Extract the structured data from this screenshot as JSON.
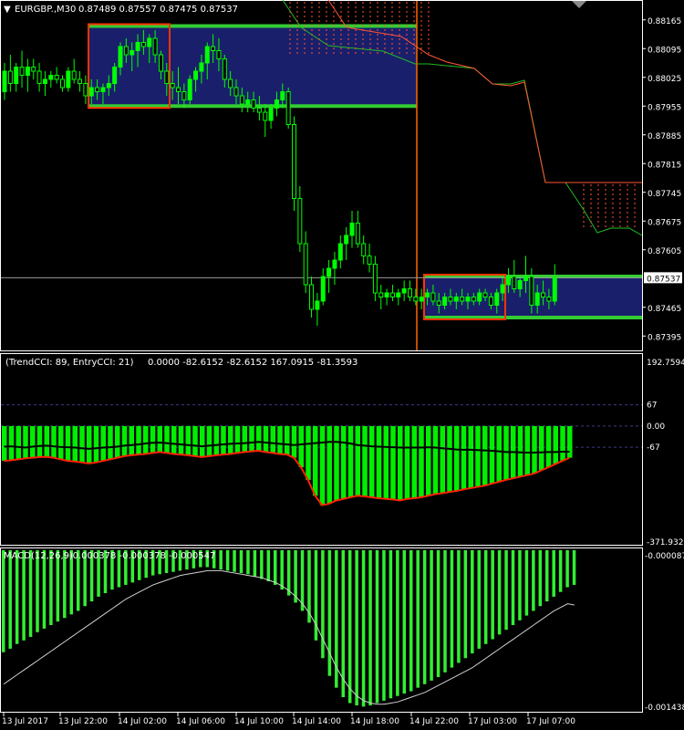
{
  "header": {
    "symbol_label": "EURGBP.,M30",
    "ohlc": "0.87489 0.87557 0.87475 0.87537"
  },
  "indicators": {
    "cci_label": "(TrendCCI: 89, EntryCCI: 21)",
    "cci_values": "0.0000 -82.6152 -82.6152 167.0915 -81.3593",
    "macd_label": "MACD(12,26,9)",
    "macd_values": "-0.000378 -0.000378 -0.000547"
  },
  "colors": {
    "background": "#000000",
    "grid_text": "#ffffff",
    "bull": "#00ff00",
    "bear": "#00ff00",
    "box_fill": "#1a1f6b",
    "box_edge_green": "#33cc33",
    "box_edge_red": "#ff3300",
    "ichimoku_red": "#ff5533",
    "ichimoku_green": "#22bb22",
    "price_line": "#9a9a9a",
    "vline": "#ff6600",
    "cci_hist": "#00ee00",
    "cci_line_red": "#ff2200",
    "cci_line_black": "#000000",
    "macd_hist": "#33ee33",
    "macd_signal": "#cfcfcf"
  },
  "chart_data": [
    {
      "type": "candlestick",
      "title": "EURGBP.,M30",
      "price_axis_ticks": [
        "0.88165",
        "0.88095",
        "0.88025",
        "0.87955",
        "0.87885",
        "0.87815",
        "0.87745",
        "0.87675",
        "0.87605",
        "0.87537",
        "0.87465",
        "0.87395"
      ],
      "current_price_label": "0.87537",
      "ylim": [
        0.8736,
        0.882
      ],
      "time_axis_labels": [
        "13 Jul 2017",
        "13 Jul 22:00",
        "14 Jul 02:00",
        "14 Jul 06:00",
        "14 Jul 10:00",
        "14 Jul 14:00",
        "14 Jul 18:00",
        "14 Jul 22:00",
        "17 Jul 03:00",
        "17 Jul 07:00"
      ],
      "candles": [
        [
          0.8799,
          0.8806,
          0.8797,
          0.8804
        ],
        [
          0.8804,
          0.8808,
          0.8799,
          0.8801
        ],
        [
          0.8801,
          0.8806,
          0.8799,
          0.8805
        ],
        [
          0.8805,
          0.8809,
          0.88,
          0.8803
        ],
        [
          0.8803,
          0.8807,
          0.8799,
          0.8805
        ],
        [
          0.8805,
          0.8807,
          0.8802,
          0.8804
        ],
        [
          0.8804,
          0.8806,
          0.8799,
          0.8801
        ],
        [
          0.8801,
          0.8804,
          0.8798,
          0.8802
        ],
        [
          0.8802,
          0.8804,
          0.88,
          0.8803
        ],
        [
          0.8803,
          0.8805,
          0.8801,
          0.8802
        ],
        [
          0.8802,
          0.8803,
          0.8799,
          0.88
        ],
        [
          0.88,
          0.8805,
          0.8799,
          0.8804
        ],
        [
          0.8804,
          0.8807,
          0.8801,
          0.8802
        ],
        [
          0.8802,
          0.8804,
          0.8799,
          0.8801
        ],
        [
          0.8801,
          0.8803,
          0.8796,
          0.8798
        ],
        [
          0.8798,
          0.8802,
          0.8796,
          0.88
        ],
        [
          0.88,
          0.8802,
          0.8797,
          0.8799
        ],
        [
          0.8799,
          0.8801,
          0.8796,
          0.88
        ],
        [
          0.88,
          0.8803,
          0.8798,
          0.8801
        ],
        [
          0.8801,
          0.8806,
          0.8799,
          0.8805
        ],
        [
          0.8805,
          0.8811,
          0.8803,
          0.881
        ],
        [
          0.881,
          0.8812,
          0.8806,
          0.8808
        ],
        [
          0.8808,
          0.8811,
          0.8804,
          0.8809
        ],
        [
          0.8809,
          0.8813,
          0.8805,
          0.8811
        ],
        [
          0.8811,
          0.8814,
          0.8808,
          0.881
        ],
        [
          0.881,
          0.8813,
          0.8806,
          0.8812
        ],
        [
          0.8812,
          0.8814,
          0.8806,
          0.8808
        ],
        [
          0.8808,
          0.8809,
          0.8802,
          0.8804
        ],
        [
          0.8804,
          0.8806,
          0.8798,
          0.8801
        ],
        [
          0.8801,
          0.8804,
          0.8797,
          0.88
        ],
        [
          0.88,
          0.8805,
          0.8796,
          0.8799
        ],
        [
          0.8799,
          0.8801,
          0.8795,
          0.8797
        ],
        [
          0.8797,
          0.8803,
          0.8796,
          0.8802
        ],
        [
          0.8802,
          0.8805,
          0.8799,
          0.8804
        ],
        [
          0.8804,
          0.8808,
          0.8801,
          0.8806
        ],
        [
          0.8806,
          0.8811,
          0.8802,
          0.881
        ],
        [
          0.881,
          0.8813,
          0.8806,
          0.8809
        ],
        [
          0.8809,
          0.8812,
          0.8804,
          0.8807
        ],
        [
          0.8807,
          0.8808,
          0.88,
          0.8802
        ],
        [
          0.8802,
          0.8804,
          0.8798,
          0.88
        ],
        [
          0.88,
          0.8802,
          0.8796,
          0.8798
        ],
        [
          0.8798,
          0.88,
          0.8794,
          0.8796
        ],
        [
          0.8796,
          0.8799,
          0.8794,
          0.8797
        ],
        [
          0.8797,
          0.8799,
          0.8794,
          0.8795
        ],
        [
          0.8795,
          0.8798,
          0.8792,
          0.8794
        ],
        [
          0.8794,
          0.8796,
          0.8788,
          0.8792
        ],
        [
          0.8792,
          0.8796,
          0.879,
          0.8795
        ],
        [
          0.8795,
          0.8799,
          0.8793,
          0.8797
        ],
        [
          0.8797,
          0.8801,
          0.8795,
          0.8799
        ],
        [
          0.8799,
          0.88,
          0.879,
          0.8791
        ],
        [
          0.8791,
          0.8793,
          0.877,
          0.8773
        ],
        [
          0.8773,
          0.8776,
          0.876,
          0.8762
        ],
        [
          0.8762,
          0.8765,
          0.875,
          0.8752
        ],
        [
          0.8752,
          0.8754,
          0.8744,
          0.8746
        ],
        [
          0.8746,
          0.875,
          0.8742,
          0.8748
        ],
        [
          0.8748,
          0.8756,
          0.8747,
          0.8754
        ],
        [
          0.8754,
          0.8758,
          0.875,
          0.8756
        ],
        [
          0.8756,
          0.876,
          0.8752,
          0.8758
        ],
        [
          0.8758,
          0.8764,
          0.8756,
          0.8762
        ],
        [
          0.8762,
          0.8766,
          0.8758,
          0.8764
        ],
        [
          0.8764,
          0.877,
          0.8761,
          0.8767
        ],
        [
          0.8767,
          0.877,
          0.8761,
          0.8762
        ],
        [
          0.8762,
          0.8764,
          0.8757,
          0.8759
        ],
        [
          0.8759,
          0.8762,
          0.8755,
          0.8757
        ],
        [
          0.8757,
          0.8759,
          0.8748,
          0.875
        ],
        [
          0.875,
          0.8752,
          0.8746,
          0.8749
        ],
        [
          0.8749,
          0.8751,
          0.8747,
          0.875
        ],
        [
          0.875,
          0.8752,
          0.8748,
          0.8749
        ],
        [
          0.8749,
          0.8751,
          0.8747,
          0.875
        ],
        [
          0.875,
          0.8753,
          0.8748,
          0.8751
        ],
        [
          0.8751,
          0.8753,
          0.8748,
          0.8749
        ],
        [
          0.8749,
          0.8751,
          0.8747,
          0.8748
        ],
        [
          0.8748,
          0.8751,
          0.8746,
          0.8749
        ],
        [
          0.8749,
          0.8751,
          0.8747,
          0.875
        ],
        [
          0.875,
          0.8752,
          0.8747,
          0.8748
        ],
        [
          0.8748,
          0.875,
          0.8745,
          0.8747
        ],
        [
          0.8747,
          0.875,
          0.8746,
          0.8749
        ],
        [
          0.8749,
          0.8751,
          0.8747,
          0.8748
        ],
        [
          0.8748,
          0.875,
          0.8746,
          0.8749
        ],
        [
          0.8749,
          0.8751,
          0.8747,
          0.8748
        ],
        [
          0.8748,
          0.875,
          0.8746,
          0.8749
        ],
        [
          0.8749,
          0.875,
          0.8747,
          0.8748
        ],
        [
          0.8748,
          0.8751,
          0.8747,
          0.875
        ],
        [
          0.875,
          0.8751,
          0.8748,
          0.8749
        ],
        [
          0.8749,
          0.875,
          0.8746,
          0.8747
        ],
        [
          0.8747,
          0.8751,
          0.8745,
          0.875
        ],
        [
          0.875,
          0.8754,
          0.8748,
          0.8752
        ],
        [
          0.8752,
          0.8756,
          0.875,
          0.8754
        ],
        [
          0.8754,
          0.8758,
          0.875,
          0.8751
        ],
        [
          0.8751,
          0.8754,
          0.8749,
          0.8753
        ],
        [
          0.8753,
          0.8759,
          0.875,
          0.8754
        ],
        [
          0.8754,
          0.8756,
          0.8745,
          0.8747
        ],
        [
          0.8747,
          0.8752,
          0.8745,
          0.875
        ],
        [
          0.875,
          0.8753,
          0.8747,
          0.8749
        ],
        [
          0.8749,
          0.8751,
          0.8746,
          0.8748
        ],
        [
          0.8748,
          0.8757,
          0.8747,
          0.87537
        ]
      ],
      "zones": [
        {
          "from_bar": 0,
          "to_bar": 64,
          "top": 0.8815,
          "bottom": 0.87955,
          "label": ""
        },
        {
          "from_bar": 66,
          "to_bar": 99,
          "top": 0.8754,
          "bottom": 0.8744,
          "label": ""
        }
      ],
      "entry_boxes": [
        {
          "from_bar": 14,
          "to_bar": 26,
          "top": 0.8815,
          "bottom": 0.87955
        },
        {
          "from_bar": 66,
          "to_bar": 77,
          "top": 0.8754,
          "bottom": 0.8744
        }
      ],
      "vertical_marker_bar": 65
    },
    {
      "type": "histogram",
      "title": "(TrendCCI: 89, EntryCCI: 21)",
      "axis_ticks": [
        "192.7594",
        "67",
        "0.00",
        "-67",
        "-371.9327"
      ],
      "ylim": [
        -371.9327,
        192.7594
      ],
      "levels": [
        67,
        0,
        -67
      ],
      "trend_cci": [
        -65,
        -64,
        -66,
        -68,
        -65,
        -63,
        -62,
        -64,
        -66,
        -67,
        -68,
        -70,
        -72,
        -70,
        -68,
        -67,
        -65,
        -62,
        -60,
        -58,
        -55,
        -53,
        -52,
        -54,
        -56,
        -58,
        -60,
        -62,
        -64,
        -62,
        -60,
        -58,
        -56,
        -55,
        -54,
        -52,
        -50,
        -52,
        -54,
        -56,
        -58,
        -60,
        -58,
        -56,
        -54,
        -52,
        -50,
        -50,
        -52,
        -55,
        -60,
        -62,
        -64,
        -65,
        -66,
        -67,
        -68,
        -68,
        -68,
        -68,
        -67,
        -68,
        -70,
        -72,
        -74,
        -75,
        -75,
        -76,
        -77,
        -78,
        -80,
        -82,
        -82,
        -83,
        -84,
        -84,
        -83,
        -82,
        -82,
        -81,
        -81
      ],
      "entry_cci": [
        -110,
        -108,
        -105,
        -102,
        -100,
        -98,
        -97,
        -100,
        -105,
        -110,
        -112,
        -115,
        -118,
        -115,
        -110,
        -105,
        -100,
        -95,
        -92,
        -90,
        -88,
        -85,
        -82,
        -85,
        -88,
        -90,
        -92,
        -95,
        -98,
        -95,
        -92,
        -90,
        -88,
        -85,
        -82,
        -80,
        -78,
        -82,
        -85,
        -88,
        -90,
        -100,
        -130,
        -170,
        -220,
        -250,
        -245,
        -235,
        -230,
        -225,
        -220,
        -222,
        -225,
        -228,
        -230,
        -232,
        -235,
        -230,
        -228,
        -225,
        -220,
        -215,
        -212,
        -208,
        -205,
        -200,
        -196,
        -192,
        -188,
        -182,
        -176,
        -170,
        -165,
        -160,
        -155,
        -150,
        -140,
        -130,
        -120,
        -110,
        -100
      ]
    },
    {
      "type": "histogram",
      "title": "MACD(12,26,9)",
      "axis_ticks": [
        "-0.000087",
        "-0.001438"
      ],
      "ylim": [
        -0.001438,
        -8.7e-05
      ],
      "macd": [
        -0.00095,
        -0.00092,
        -0.00088,
        -0.00085,
        -0.00082,
        -0.00078,
        -0.00075,
        -0.00072,
        -0.00069,
        -0.00066,
        -0.00063,
        -0.0006,
        -0.00056,
        -0.00052,
        -0.00048,
        -0.00045,
        -0.00042,
        -0.0004,
        -0.00038,
        -0.00036,
        -0.00034,
        -0.00032,
        -0.0003,
        -0.00029,
        -0.00028,
        -0.00027,
        -0.00026,
        -0.00025,
        -0.00024,
        -0.00023,
        -0.00023,
        -0.00024,
        -0.00025,
        -0.00026,
        -0.00027,
        -0.00028,
        -0.00029,
        -0.00031,
        -0.00033,
        -0.00035,
        -0.00038,
        -0.00042,
        -0.00047,
        -0.00053,
        -0.0006,
        -0.0007,
        -0.00085,
        -0.001,
        -0.00115,
        -0.00125,
        -0.00133,
        -0.00138,
        -0.0014,
        -0.00141,
        -0.0014,
        -0.00138,
        -0.00136,
        -0.00134,
        -0.00132,
        -0.0013,
        -0.00128,
        -0.00125,
        -0.00122,
        -0.00119,
        -0.00116,
        -0.00112,
        -0.00108,
        -0.00104,
        -0.001,
        -0.00096,
        -0.00092,
        -0.00088,
        -0.00084,
        -0.0008,
        -0.00076,
        -0.00072,
        -0.00068,
        -0.00064,
        -0.0006,
        -0.00056,
        -0.00052,
        -0.00048,
        -0.00044,
        -0.0004,
        -0.00038
      ],
      "signal": [
        -0.00122,
        -0.00118,
        -0.00114,
        -0.0011,
        -0.00106,
        -0.00102,
        -0.00098,
        -0.00094,
        -0.0009,
        -0.00086,
        -0.00082,
        -0.00078,
        -0.00074,
        -0.0007,
        -0.00066,
        -0.00062,
        -0.00058,
        -0.00054,
        -0.0005,
        -0.00047,
        -0.00044,
        -0.00041,
        -0.00038,
        -0.00036,
        -0.00034,
        -0.00032,
        -0.0003,
        -0.00029,
        -0.00028,
        -0.00027,
        -0.00026,
        -0.00026,
        -0.00026,
        -0.00027,
        -0.00028,
        -0.00029,
        -0.0003,
        -0.00031,
        -0.00032,
        -0.00034,
        -0.00036,
        -0.00039,
        -0.00043,
        -0.00048,
        -0.00054,
        -0.00062,
        -0.00072,
        -0.00084,
        -0.00096,
        -0.00108,
        -0.00118,
        -0.00126,
        -0.00132,
        -0.00136,
        -0.00138,
        -0.00139,
        -0.00139,
        -0.00138,
        -0.00137,
        -0.00135,
        -0.00133,
        -0.00131,
        -0.00129,
        -0.00126,
        -0.00123,
        -0.0012,
        -0.00117,
        -0.00114,
        -0.00111,
        -0.00108,
        -0.00104,
        -0.001,
        -0.00096,
        -0.00092,
        -0.00088,
        -0.00084,
        -0.0008,
        -0.00076,
        -0.00072,
        -0.00068,
        -0.00064,
        -0.0006,
        -0.00057,
        -0.00054,
        -0.00055
      ]
    }
  ]
}
